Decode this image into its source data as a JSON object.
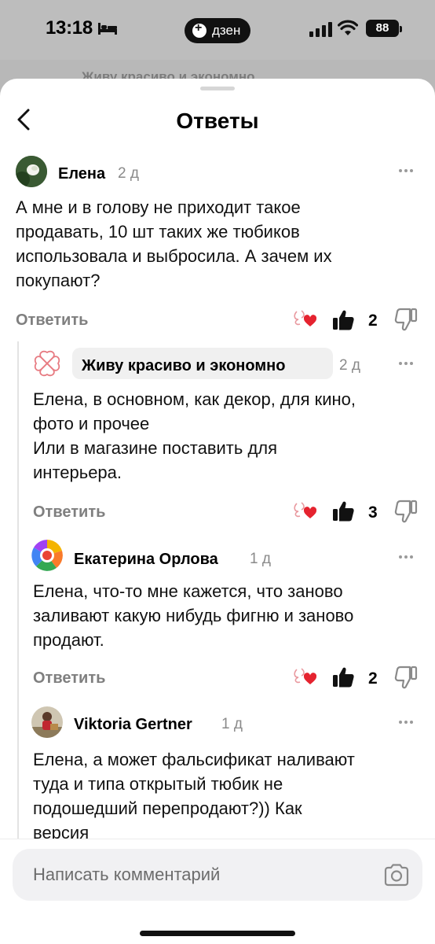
{
  "status_bar": {
    "time": "13:18",
    "pill_label": "дзен",
    "battery": "88"
  },
  "background_channel_title": "Живу красиво и экономно",
  "sheet": {
    "title": "Ответы",
    "back_icon": "chevron-left-icon"
  },
  "reply_label": "Ответить",
  "comments": [
    {
      "author": "Елена",
      "age": "2 д",
      "text": "А мне и в голову не приходит такое\nпродавать, 10 шт таких же тюбиков\nиспользовала и выбросила. А зачем их\nпокупают?",
      "likes": "2"
    },
    {
      "author": "Живу красиво и экономно",
      "age": "2 д",
      "text": "Елена, в основном, как декор, для кино,\nфото и прочее\nИли в магазине поставить для\nинтерьера.",
      "likes": "3"
    },
    {
      "author": "Екатерина Орлова",
      "age": "1 д",
      "text": "Елена, что-то мне кажется, что заново\nзаливают какую нибудь фигню и заново\nпродают.",
      "likes": "2"
    },
    {
      "author": "Viktoria Gertner",
      "age": "1 д",
      "text": "Елена, а может фальсификат наливают\nтуда и типа открытый тюбик не\nподошедший перепродают?)) Как\nверсия"
    }
  ],
  "composer": {
    "placeholder": "Написать комментарий",
    "camera_icon": "camera-icon"
  },
  "colors": {
    "heart": "#e5232f",
    "brand_logo": "#e77b82",
    "muted": "#7f7f7f"
  }
}
